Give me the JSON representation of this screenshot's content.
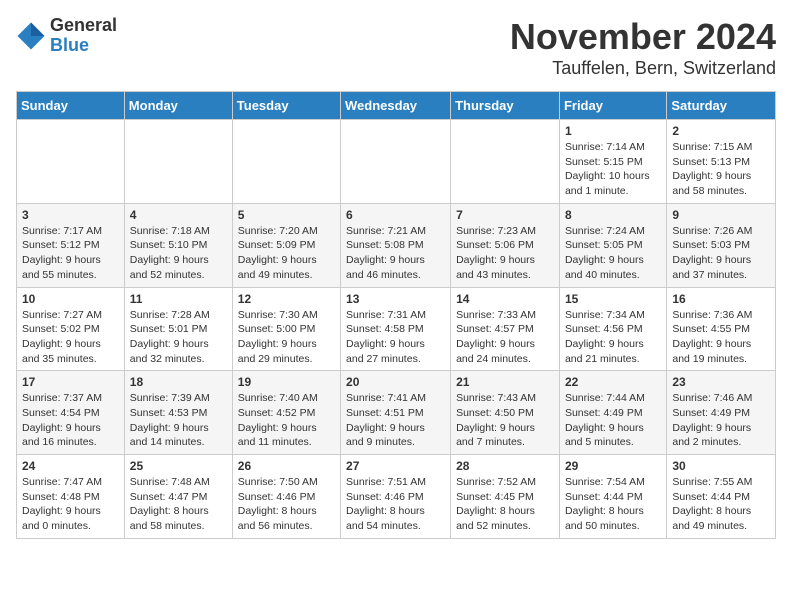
{
  "logo": {
    "general": "General",
    "blue": "Blue"
  },
  "title": {
    "month": "November 2024",
    "location": "Tauffelen, Bern, Switzerland"
  },
  "weekdays": [
    "Sunday",
    "Monday",
    "Tuesday",
    "Wednesday",
    "Thursday",
    "Friday",
    "Saturday"
  ],
  "weeks": [
    [
      {
        "day": "",
        "info": ""
      },
      {
        "day": "",
        "info": ""
      },
      {
        "day": "",
        "info": ""
      },
      {
        "day": "",
        "info": ""
      },
      {
        "day": "",
        "info": ""
      },
      {
        "day": "1",
        "info": "Sunrise: 7:14 AM\nSunset: 5:15 PM\nDaylight: 10 hours and 1 minute."
      },
      {
        "day": "2",
        "info": "Sunrise: 7:15 AM\nSunset: 5:13 PM\nDaylight: 9 hours and 58 minutes."
      }
    ],
    [
      {
        "day": "3",
        "info": "Sunrise: 7:17 AM\nSunset: 5:12 PM\nDaylight: 9 hours and 55 minutes."
      },
      {
        "day": "4",
        "info": "Sunrise: 7:18 AM\nSunset: 5:10 PM\nDaylight: 9 hours and 52 minutes."
      },
      {
        "day": "5",
        "info": "Sunrise: 7:20 AM\nSunset: 5:09 PM\nDaylight: 9 hours and 49 minutes."
      },
      {
        "day": "6",
        "info": "Sunrise: 7:21 AM\nSunset: 5:08 PM\nDaylight: 9 hours and 46 minutes."
      },
      {
        "day": "7",
        "info": "Sunrise: 7:23 AM\nSunset: 5:06 PM\nDaylight: 9 hours and 43 minutes."
      },
      {
        "day": "8",
        "info": "Sunrise: 7:24 AM\nSunset: 5:05 PM\nDaylight: 9 hours and 40 minutes."
      },
      {
        "day": "9",
        "info": "Sunrise: 7:26 AM\nSunset: 5:03 PM\nDaylight: 9 hours and 37 minutes."
      }
    ],
    [
      {
        "day": "10",
        "info": "Sunrise: 7:27 AM\nSunset: 5:02 PM\nDaylight: 9 hours and 35 minutes."
      },
      {
        "day": "11",
        "info": "Sunrise: 7:28 AM\nSunset: 5:01 PM\nDaylight: 9 hours and 32 minutes."
      },
      {
        "day": "12",
        "info": "Sunrise: 7:30 AM\nSunset: 5:00 PM\nDaylight: 9 hours and 29 minutes."
      },
      {
        "day": "13",
        "info": "Sunrise: 7:31 AM\nSunset: 4:58 PM\nDaylight: 9 hours and 27 minutes."
      },
      {
        "day": "14",
        "info": "Sunrise: 7:33 AM\nSunset: 4:57 PM\nDaylight: 9 hours and 24 minutes."
      },
      {
        "day": "15",
        "info": "Sunrise: 7:34 AM\nSunset: 4:56 PM\nDaylight: 9 hours and 21 minutes."
      },
      {
        "day": "16",
        "info": "Sunrise: 7:36 AM\nSunset: 4:55 PM\nDaylight: 9 hours and 19 minutes."
      }
    ],
    [
      {
        "day": "17",
        "info": "Sunrise: 7:37 AM\nSunset: 4:54 PM\nDaylight: 9 hours and 16 minutes."
      },
      {
        "day": "18",
        "info": "Sunrise: 7:39 AM\nSunset: 4:53 PM\nDaylight: 9 hours and 14 minutes."
      },
      {
        "day": "19",
        "info": "Sunrise: 7:40 AM\nSunset: 4:52 PM\nDaylight: 9 hours and 11 minutes."
      },
      {
        "day": "20",
        "info": "Sunrise: 7:41 AM\nSunset: 4:51 PM\nDaylight: 9 hours and 9 minutes."
      },
      {
        "day": "21",
        "info": "Sunrise: 7:43 AM\nSunset: 4:50 PM\nDaylight: 9 hours and 7 minutes."
      },
      {
        "day": "22",
        "info": "Sunrise: 7:44 AM\nSunset: 4:49 PM\nDaylight: 9 hours and 5 minutes."
      },
      {
        "day": "23",
        "info": "Sunrise: 7:46 AM\nSunset: 4:49 PM\nDaylight: 9 hours and 2 minutes."
      }
    ],
    [
      {
        "day": "24",
        "info": "Sunrise: 7:47 AM\nSunset: 4:48 PM\nDaylight: 9 hours and 0 minutes."
      },
      {
        "day": "25",
        "info": "Sunrise: 7:48 AM\nSunset: 4:47 PM\nDaylight: 8 hours and 58 minutes."
      },
      {
        "day": "26",
        "info": "Sunrise: 7:50 AM\nSunset: 4:46 PM\nDaylight: 8 hours and 56 minutes."
      },
      {
        "day": "27",
        "info": "Sunrise: 7:51 AM\nSunset: 4:46 PM\nDaylight: 8 hours and 54 minutes."
      },
      {
        "day": "28",
        "info": "Sunrise: 7:52 AM\nSunset: 4:45 PM\nDaylight: 8 hours and 52 minutes."
      },
      {
        "day": "29",
        "info": "Sunrise: 7:54 AM\nSunset: 4:44 PM\nDaylight: 8 hours and 50 minutes."
      },
      {
        "day": "30",
        "info": "Sunrise: 7:55 AM\nSunset: 4:44 PM\nDaylight: 8 hours and 49 minutes."
      }
    ]
  ]
}
